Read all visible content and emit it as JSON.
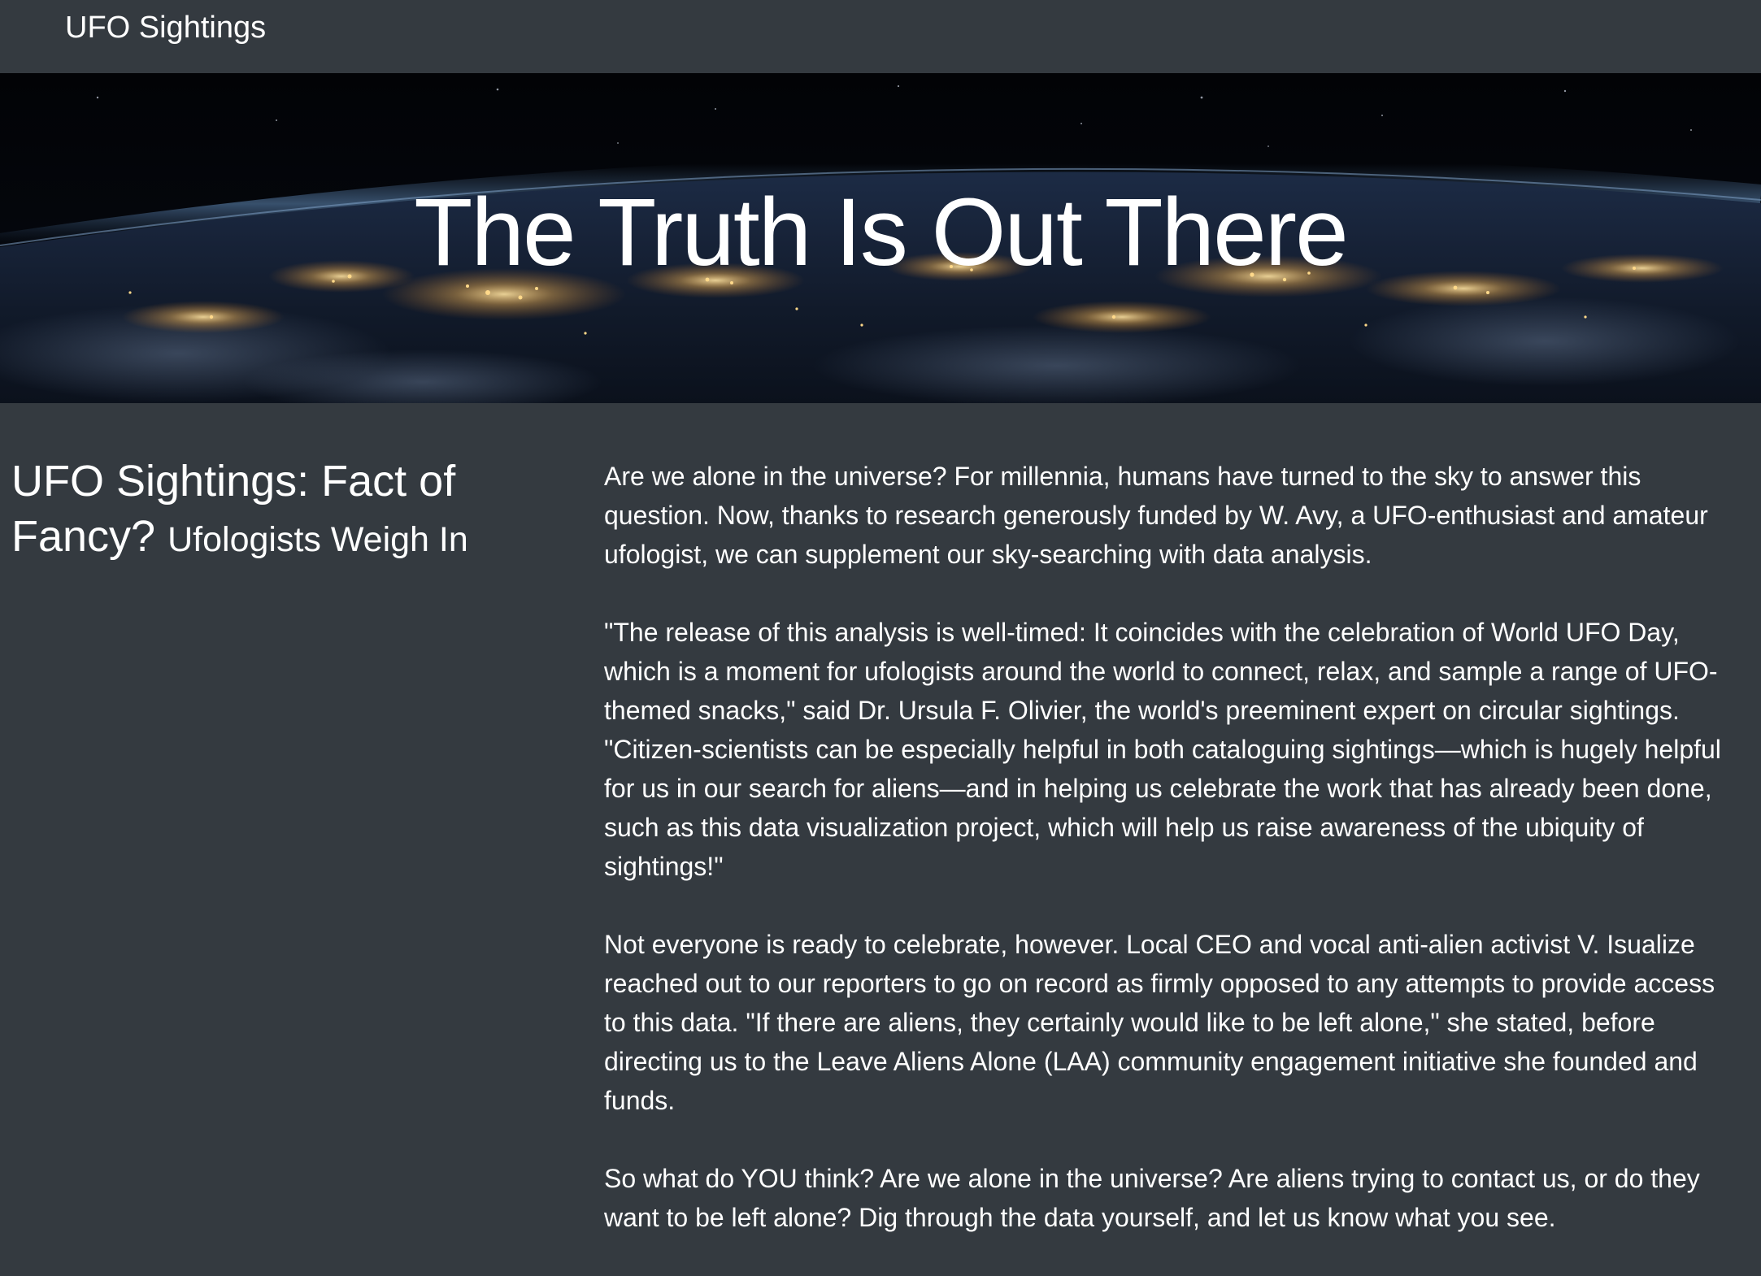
{
  "navbar": {
    "brand": "UFO Sightings"
  },
  "hero": {
    "title": "The Truth Is Out There",
    "image_description": "earth-at-night-from-orbit"
  },
  "article": {
    "headline": "UFO Sightings: Fact of Fancy?",
    "subheadline": "Ufologists Weigh In",
    "paragraphs": [
      "Are we alone in the universe? For millennia, humans have turned to the sky to answer this question. Now, thanks to research generously funded by W. Avy, a UFO-enthusiast and amateur ufologist, we can supplement our sky-searching with data analysis.",
      "\"The release of this analysis is well-timed: It coincides with the celebration of World UFO Day, which is a moment for ufologists around the world to connect, relax, and sample a range of UFO-themed snacks,\" said Dr. Ursula F. Olivier, the world's preeminent expert on circular sightings. \"Citizen-scientists can be especially helpful in both cataloguing sightings—which is hugely helpful for us in our search for aliens—and in helping us celebrate the work that has already been done, such as this data visualization project, which will help us raise awareness of the ubiquity of sightings!\"",
      "Not everyone is ready to celebrate, however. Local CEO and vocal anti-alien activist V. Isualize reached out to our reporters to go on record as firmly opposed to any attempts to provide access to this data. \"If there are aliens, they certainly would like to be left alone,\" she stated, before directing us to the Leave Aliens Alone (LAA) community engagement initiative she founded and funds.",
      "So what do YOU think? Are we alone in the universe? Are aliens trying to contact us, or do they want to be left alone? Dig through the data yourself, and let us know what you see."
    ]
  },
  "colors": {
    "background": "#343a40",
    "text": "#ffffff",
    "space": "#05070c",
    "city_lights": "#ffd27a"
  }
}
